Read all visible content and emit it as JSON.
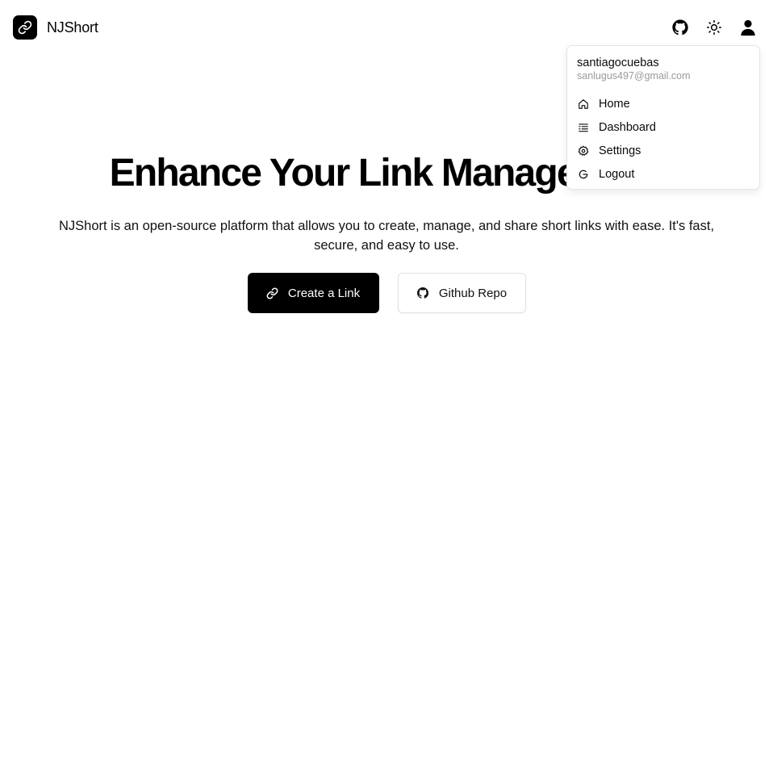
{
  "header": {
    "brand_name": "NJShort",
    "actions": [
      {
        "icon": "github-icon"
      },
      {
        "icon": "sun-icon"
      },
      {
        "icon": "user-icon"
      }
    ]
  },
  "hero": {
    "title": "Enhance Your Link Management",
    "description": "NJShort is an open-source platform that allows you to create, manage, and share short links with ease. It's fast, secure, and easy to use.",
    "primary_button": "Create a Link",
    "secondary_button": "Github Repo"
  },
  "user_menu": {
    "username": "santiagocuebas",
    "email": "sanlugus497@gmail.com",
    "items": [
      {
        "label": "Home",
        "icon": "home-icon"
      },
      {
        "label": "Dashboard",
        "icon": "list-icon"
      },
      {
        "label": "Settings",
        "icon": "gear-icon"
      },
      {
        "label": "Logout",
        "icon": "logout-icon"
      }
    ]
  },
  "colors": {
    "primary": "#000000",
    "muted_text": "#9a9a9a",
    "border": "#e4e4e7"
  }
}
